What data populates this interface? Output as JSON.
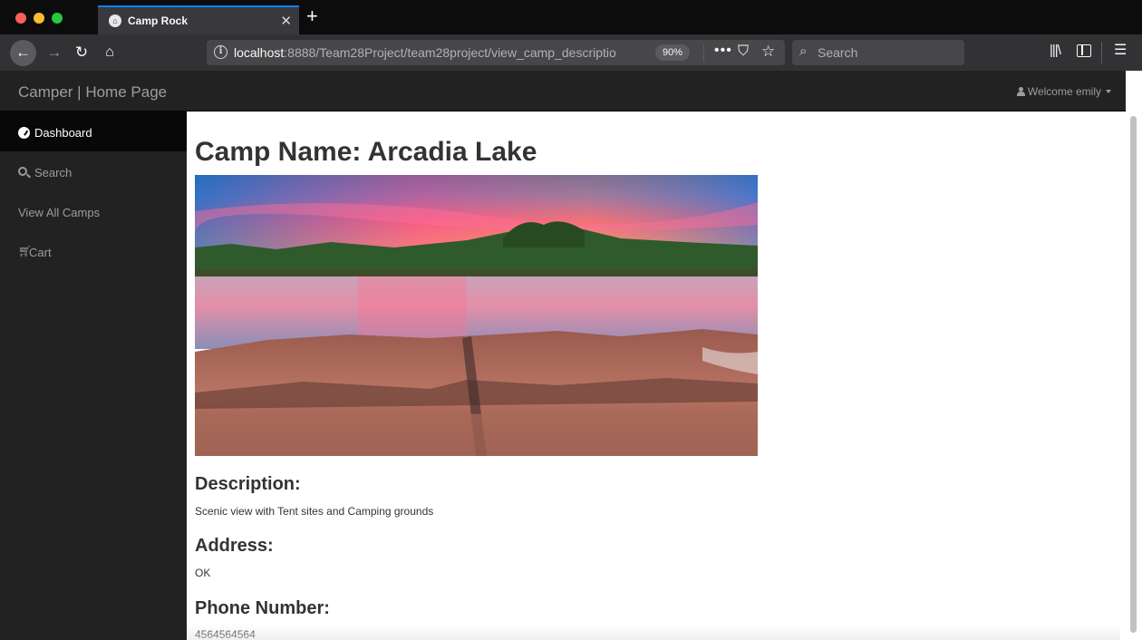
{
  "browser": {
    "tab_title": "Camp Rock",
    "url_host": "localhost",
    "url_rest": ":8888/Team28Project/team28project/view_camp_descriptio",
    "zoom": "90%",
    "search_placeholder": "Search"
  },
  "navbar": {
    "brand": "Camper | Home Page",
    "welcome": "Welcome emily"
  },
  "sidebar": {
    "items": [
      {
        "label": "Dashboard",
        "icon": "dashboard-icon",
        "active": true
      },
      {
        "label": "Search",
        "icon": "search-icon",
        "active": false
      },
      {
        "label": "View All Camps",
        "icon": "",
        "active": false
      },
      {
        "label": "Cart",
        "icon": "cart-icon",
        "active": false
      }
    ]
  },
  "camp": {
    "title": "Camp Name: Arcadia Lake",
    "image": "lake-sunset-photo",
    "description_heading": "Description:",
    "description": "Scenic view with Tent sites and Camping grounds",
    "address_heading": "Address:",
    "address": "OK",
    "phone_heading": "Phone Number:",
    "phone": "4564564564"
  }
}
